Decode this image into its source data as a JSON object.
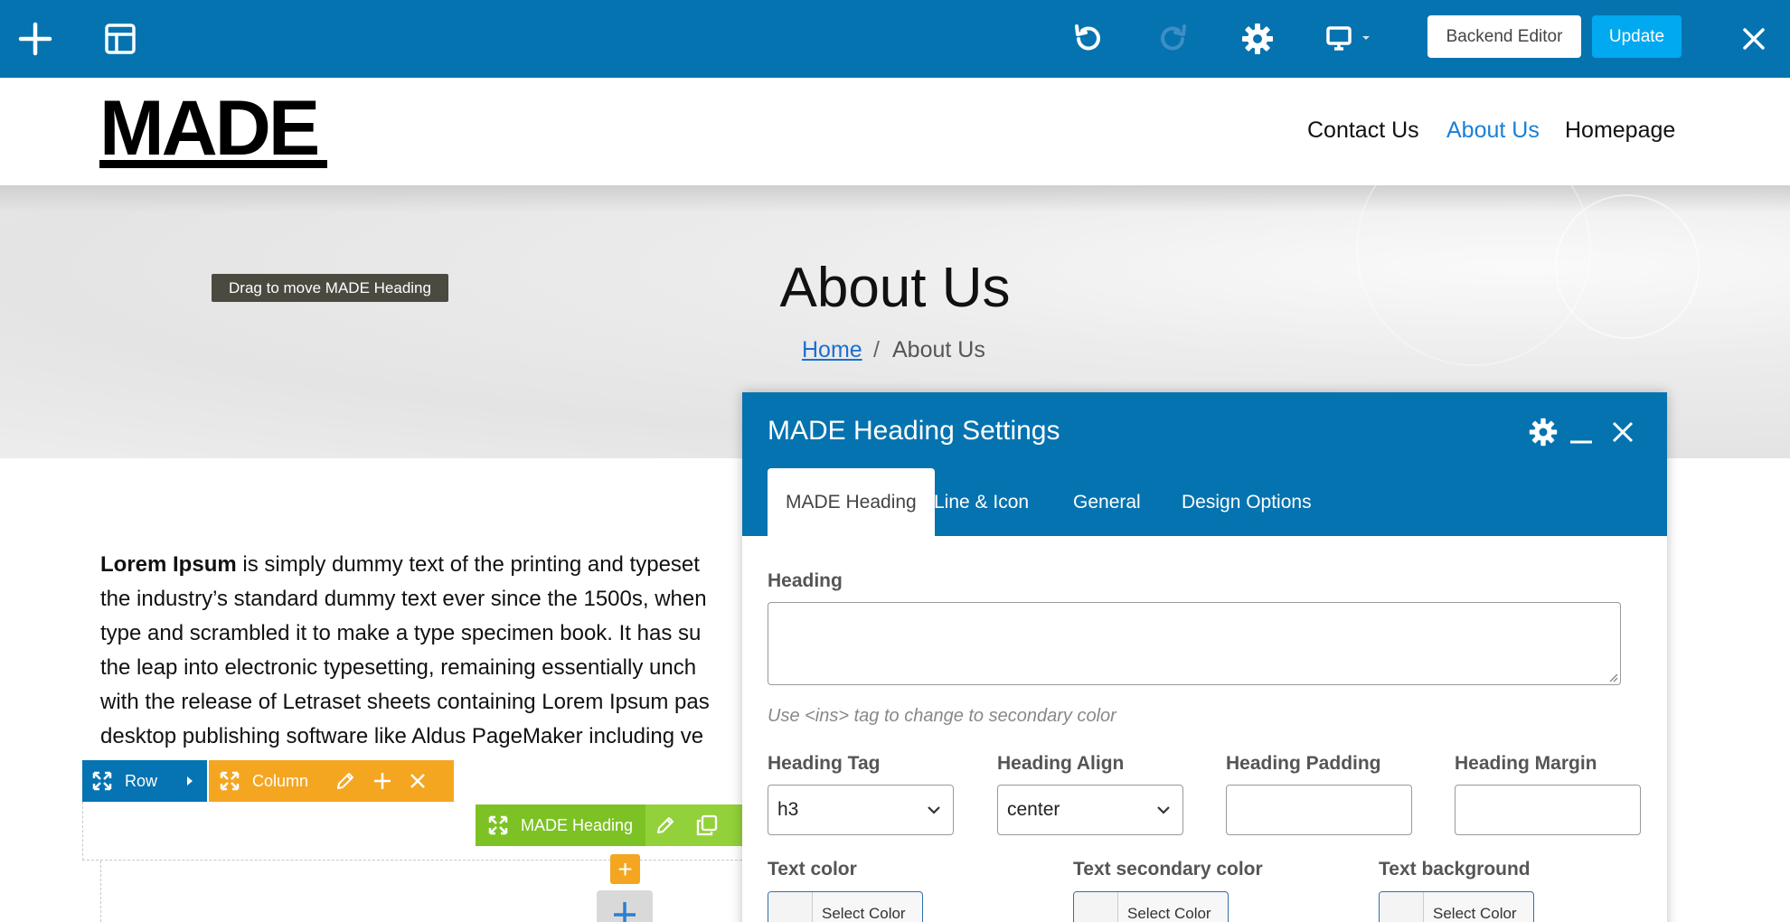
{
  "toolbar": {
    "backend_editor_label": "Backend Editor",
    "update_label": "Update"
  },
  "site": {
    "logo": "MADE",
    "nav": [
      "Contact Us",
      "About Us",
      "Homepage"
    ],
    "active_nav": "About Us"
  },
  "hero": {
    "title": "About Us",
    "breadcrumb": {
      "home": "Home",
      "separator": "/",
      "current": "About Us"
    },
    "tooltip": "Drag to move MADE Heading"
  },
  "content": {
    "bold_lead": "Lorem Ipsum",
    "lines": [
      " is simply dummy text of the printing and typeset",
      "the industry’s standard dummy text ever since the 1500s, when",
      "type and scrambled it to make a type specimen book. It has su",
      "the leap into electronic typesetting, remaining essentially unch",
      "with the release of Letraset sheets containing Lorem Ipsum pas",
      "desktop publishing software like Aldus PageMaker including ve"
    ]
  },
  "builder": {
    "row_label": "Row",
    "column_label": "Column",
    "element_label": "MADE Heading"
  },
  "modal": {
    "title": "MADE Heading Settings",
    "tabs": [
      "MADE Heading",
      "Line & Icon",
      "General",
      "Design Options"
    ],
    "active_tab": 0,
    "heading_label": "Heading",
    "heading_value": "",
    "hint": "Use <ins> tag to change to secondary color",
    "tag_label": "Heading Tag",
    "tag_value": "h3",
    "align_label": "Heading Align",
    "align_value": "center",
    "padding_label": "Heading Padding",
    "padding_value": "",
    "margin_label": "Heading Margin",
    "margin_value": "",
    "text_color_label": "Text color",
    "text_secondary_label": "Text secondary color",
    "text_background_label": "Text background",
    "select_color_label": "Select Color"
  },
  "colors": {
    "editor_blue": "#0573b0",
    "update_blue": "#00a9f0",
    "row_blue": "#0673b2",
    "column_orange": "#f4a621",
    "element_green": "#7cc224",
    "link_blue": "#1a7fd6"
  }
}
